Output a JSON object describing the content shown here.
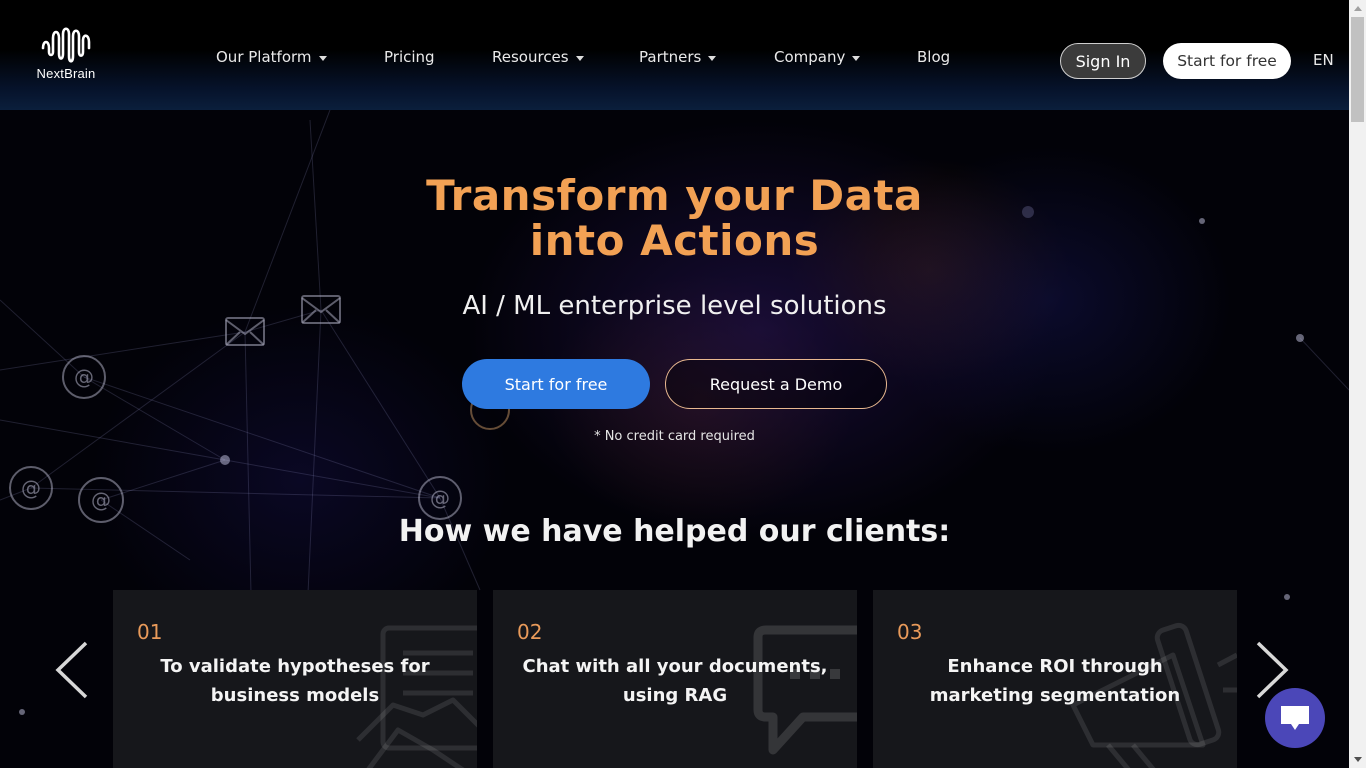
{
  "brand": {
    "name": "NextBrain",
    "accent": "#f2a154",
    "primary_blue": "#2e7ae0",
    "chat_color": "#4b47b8"
  },
  "nav": {
    "items": [
      {
        "label": "Our Platform",
        "has_dropdown": true
      },
      {
        "label": "Pricing",
        "has_dropdown": false
      },
      {
        "label": "Resources",
        "has_dropdown": true
      },
      {
        "label": "Partners",
        "has_dropdown": true
      },
      {
        "label": "Company",
        "has_dropdown": true
      },
      {
        "label": "Blog",
        "has_dropdown": false
      }
    ],
    "sign_in": "Sign In",
    "start_free": "Start for free",
    "language": "EN"
  },
  "hero": {
    "title_line1": "Transform your Data",
    "title_line2": "into Actions",
    "subtitle": "AI / ML enterprise level solutions",
    "cta_primary": "Start for free",
    "cta_secondary": "Request a Demo",
    "note": "* No credit card required"
  },
  "clients": {
    "title": "How we have helped our clients:",
    "cards": [
      {
        "number": "01",
        "title": "To validate hypotheses for business models",
        "icon": "handshake-document-icon"
      },
      {
        "number": "02",
        "title": "Chat with all your documents, using RAG",
        "icon": "chat-bubble-icon"
      },
      {
        "number": "03",
        "title": "Enhance ROI through marketing segmentation",
        "icon": "megaphone-icon"
      }
    ],
    "prev_icon": "chevron-left-icon",
    "next_icon": "chevron-right-icon"
  },
  "chat_widget": {
    "icon": "chat-icon"
  }
}
